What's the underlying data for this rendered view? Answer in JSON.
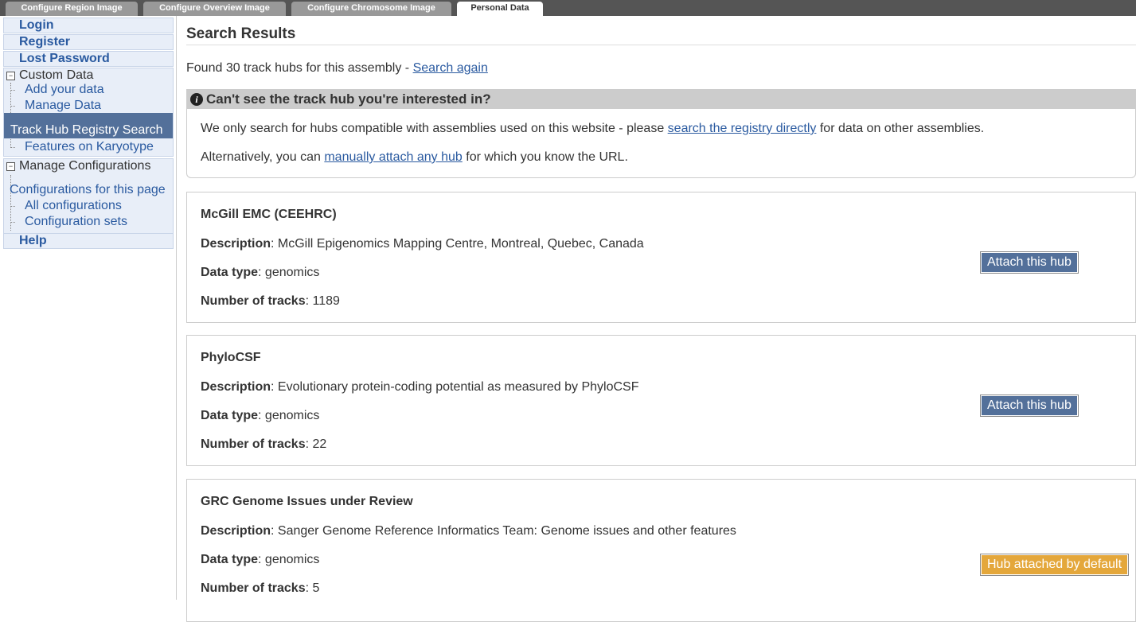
{
  "tabs": [
    {
      "label": "Configure Region Image",
      "active": false
    },
    {
      "label": "Configure Overview Image",
      "active": false
    },
    {
      "label": "Configure Chromosome Image",
      "active": false
    },
    {
      "label": "Personal Data",
      "active": true
    }
  ],
  "sidebar": {
    "login": "Login",
    "register": "Register",
    "lost_password": "Lost Password",
    "custom_data": {
      "heading": "Custom Data",
      "items": [
        "Add your data",
        "Manage Data",
        "Track Hub Registry Search",
        "Features on Karyotype"
      ],
      "active_item": "Track Hub Registry Search"
    },
    "manage_configurations": {
      "heading": "Manage Configurations",
      "items": [
        "Configurations for this page",
        "All configurations",
        "Configuration sets"
      ]
    },
    "help": "Help",
    "toggle_symbol": "−"
  },
  "main": {
    "title": "Search Results",
    "found_text": "Found 30 track hubs for this assembly - ",
    "search_again": "Search again",
    "info": {
      "heading": "Can't see the track hub you're interested in?",
      "icon": "i",
      "p1_before": "We only search for hubs compatible with assemblies used on this website - please ",
      "p1_link": "search the registry directly",
      "p1_after": " for data on other assemblies.",
      "p2_before": "Alternatively, you can ",
      "p2_link": "manually attach any hub",
      "p2_after": " for which you know the URL."
    },
    "labels": {
      "description": "Description",
      "data_type": "Data type",
      "num_tracks": "Number of tracks"
    },
    "hubs": [
      {
        "name": "McGill EMC (CEEHRC)",
        "description": "McGill Epigenomics Mapping Centre, Montreal, Quebec, Canada",
        "data_type": "genomics",
        "num_tracks": "1189",
        "button": "Attach this hub",
        "button_type": "attach"
      },
      {
        "name": "PhyloCSF",
        "description": "Evolutionary protein-coding potential as measured by PhyloCSF",
        "data_type": "genomics",
        "num_tracks": "22",
        "button": "Attach this hub",
        "button_type": "attach"
      },
      {
        "name": "GRC Genome Issues under Review",
        "description": "Sanger Genome Reference Informatics Team: Genome issues and other features",
        "data_type": "genomics",
        "num_tracks": "5",
        "button": "Hub attached by default",
        "button_type": "default"
      }
    ]
  },
  "colors": {
    "link": "#2a5aa0",
    "active_nav": "#53709a",
    "attach_button": "#53709a",
    "default_button": "#e4a73b"
  }
}
